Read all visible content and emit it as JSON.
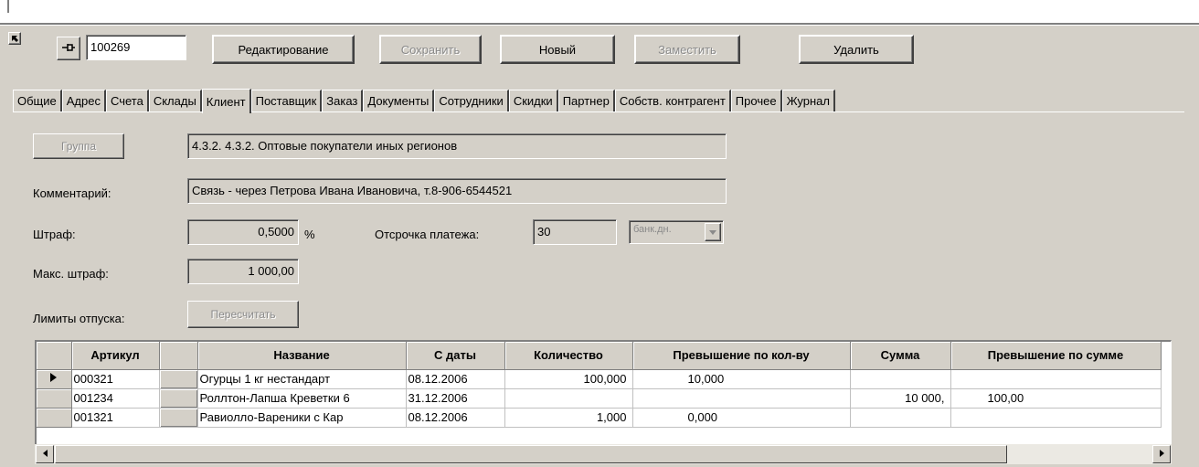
{
  "toolbar": {
    "code_value": "100269",
    "edit_label": "Редактирование",
    "save_label": "Сохранить",
    "new_label": "Новый",
    "replace_label": "Заместить",
    "delete_label": "Удалить"
  },
  "tabs": [
    {
      "label": "Общие"
    },
    {
      "label": "Адрес"
    },
    {
      "label": "Счета"
    },
    {
      "label": "Склады"
    },
    {
      "label": "Клиент",
      "active": true
    },
    {
      "label": "Поставщик"
    },
    {
      "label": "Заказ"
    },
    {
      "label": "Документы"
    },
    {
      "label": "Сотрудники"
    },
    {
      "label": "Скидки"
    },
    {
      "label": "Партнер"
    },
    {
      "label": "Собств. контрагент"
    },
    {
      "label": "Прочее"
    },
    {
      "label": "Журнал"
    }
  ],
  "form": {
    "group_button": "Группа",
    "group_value": "4.3.2. 4.3.2. Оптовые покупатели иных регионов",
    "comment_label": "Комментарий:",
    "comment_value": "Связь - через Петрова Ивана Ивановича, т.8-906-6544521",
    "penalty_label": "Штраф:",
    "penalty_value": "0,5000",
    "percent_sign": "%",
    "deferral_label": "Отсрочка платежа:",
    "deferral_value": "30",
    "deferral_unit": "банк.дн.",
    "max_penalty_label": "Макс. штраф:",
    "max_penalty_value": "1 000,00",
    "limits_label": "Лимиты отпуска:",
    "recalc_button": "Пересчитать"
  },
  "grid": {
    "columns": [
      "Артикул",
      "Название",
      "С даты",
      "Количество",
      "Превышение по кол-ву",
      "Сумма",
      "Превышение по сумме"
    ],
    "rows": [
      {
        "article": "000321",
        "name": "Огурцы 1 кг нестандарт",
        "date": "08.12.2006",
        "qty": "100,000",
        "qty_over": "10,000",
        "sum": "",
        "sum_over": "",
        "current": true
      },
      {
        "article": "001234",
        "name": "Роллтон-Лапша Креветки 6",
        "date": "31.12.2006",
        "qty": "",
        "qty_over": "",
        "sum": "10 000,",
        "sum_over": "100,00",
        "current": false
      },
      {
        "article": "001321",
        "name": "Равиолло-Вареники с Кар",
        "date": "08.12.2006",
        "qty": "1,000",
        "qty_over": "0,000",
        "sum": "",
        "sum_over": "",
        "current": false
      }
    ]
  },
  "icons": {
    "pin": "pin-icon",
    "corner": "arrow-up-left-icon",
    "row_pointer": "triangle-right-icon",
    "dropdown": "chevron-down-icon"
  }
}
